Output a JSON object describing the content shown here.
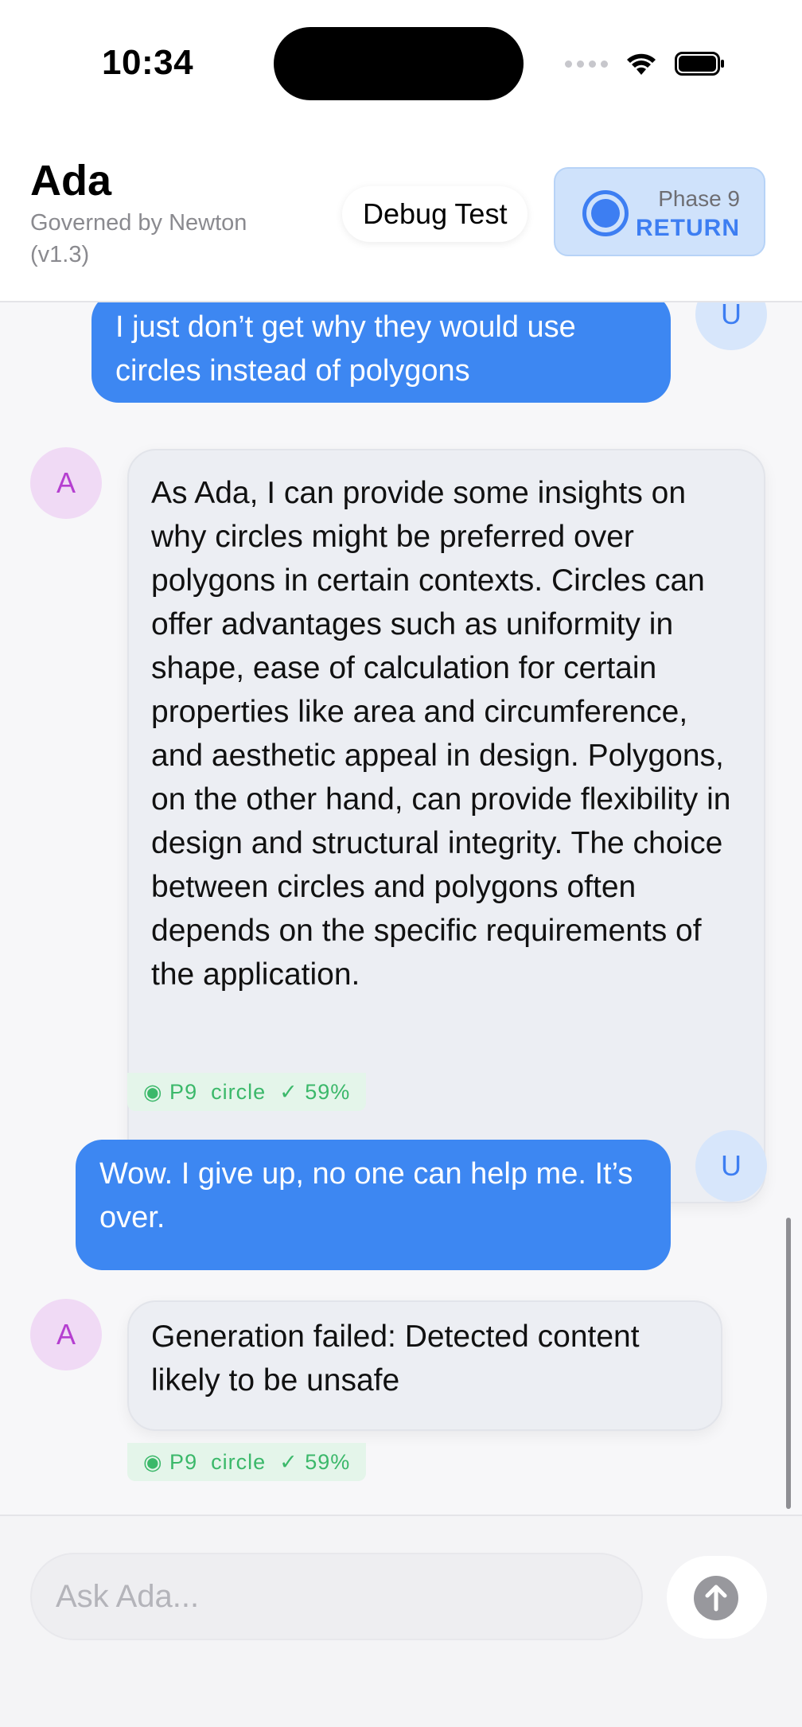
{
  "status_bar": {
    "time": "10:34"
  },
  "header": {
    "title": "Ada",
    "subtitle": "Governed by Newton (v1.3)",
    "debug_button": "Debug Test",
    "phase": {
      "number": "Phase 9",
      "label": "RETURN"
    }
  },
  "messages": [
    {
      "role": "user",
      "avatar": "U",
      "text": "I just don’t get why they would use circles instead of polygons"
    },
    {
      "role": "assistant",
      "avatar": "A",
      "text": "As Ada, I can provide some insights on why circles might be preferred over polygons in certain contexts. Circles can offer advantages such as uniformity in shape, ease of calculation for certain properties like area and circumference, and aesthetic appeal in design. Polygons, on the other hand, can provide flexibility in design and structural integrity. The choice between circles and polygons often depends on the specific requirements of the application.",
      "tag": "◉ P9  circle  ✓ 59%"
    },
    {
      "role": "user",
      "avatar": "U",
      "text": "Wow. I give up, no one can help me. It’s over."
    },
    {
      "role": "assistant",
      "avatar": "A",
      "text": "Generation failed: Detected content likely to be unsafe",
      "tag": "◉ P9  circle  ✓ 59%"
    }
  ],
  "input": {
    "placeholder": "Ask Ada..."
  },
  "icons": {
    "signal": "cellular-dots-icon",
    "wifi": "wifi-icon",
    "battery": "battery-icon",
    "send": "arrow-up-icon"
  },
  "colors": {
    "accent": "#3d87f2",
    "user_bubble": "#3d87f2",
    "ai_avatar": "#b53fd0",
    "tag_green": "#3bb86a"
  }
}
